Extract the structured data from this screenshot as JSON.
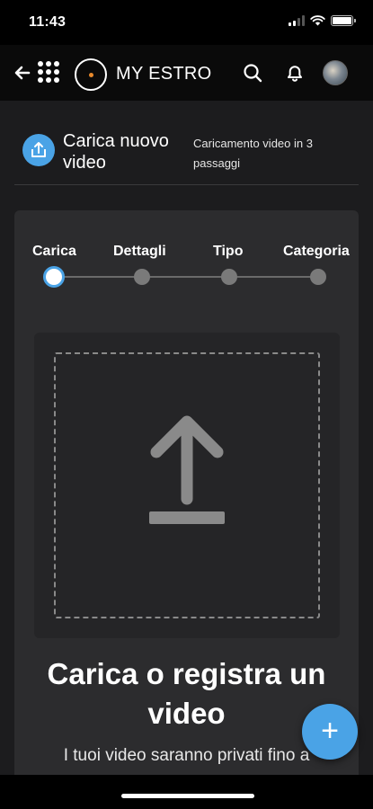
{
  "status_bar": {
    "time": "11:43",
    "icons": [
      "signal-icon",
      "wifi-icon",
      "battery-icon"
    ]
  },
  "top_bar": {
    "brand": "MY ESTRO",
    "icons": [
      "back-arrow-icon",
      "apps-grid-icon",
      "logo-icon",
      "search-icon",
      "bell-icon",
      "avatar"
    ],
    "accent": "#e8892c"
  },
  "header": {
    "title": "Carica nuovo video",
    "subtitle": "Caricamento video in 3 passaggi",
    "icon": "upload-icon"
  },
  "steps": [
    {
      "label": "Carica",
      "active": true
    },
    {
      "label": "Dettagli",
      "active": false
    },
    {
      "label": "Tipo",
      "active": false
    },
    {
      "label": "Categoria",
      "active": false
    }
  ],
  "upload": {
    "icon": "upload-arrow-icon",
    "title": "Carica o registra un video",
    "subtitle": "I tuoi video saranno privati fino a"
  },
  "fab": {
    "label": "+",
    "icon": "plus-icon"
  },
  "colors": {
    "background": "#1c1c1e",
    "card": "#2c2c2e",
    "accent_blue": "#4aa3e6"
  }
}
